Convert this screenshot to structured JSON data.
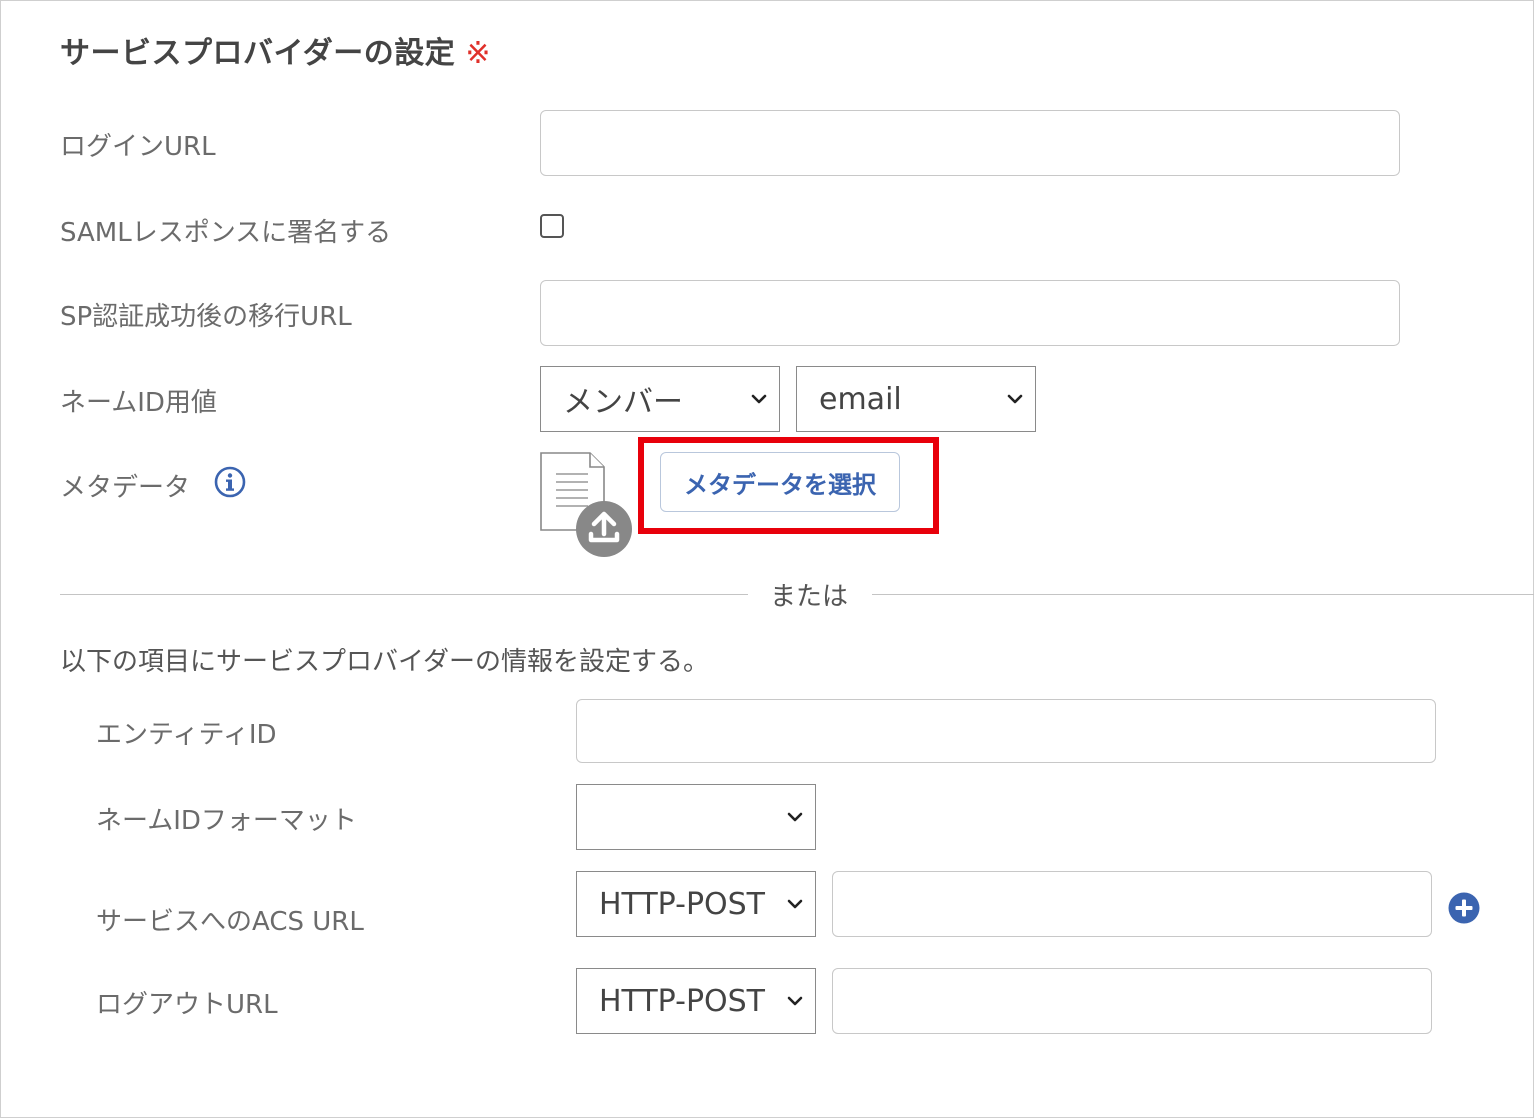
{
  "section": {
    "title": "サービスプロバイダーの設定",
    "required_mark": "※"
  },
  "fields": {
    "login_url": {
      "label": "ログインURL",
      "value": ""
    },
    "saml_sign": {
      "label": "SAMLレスポンスに署名する",
      "checked": false
    },
    "sp_redirect_url": {
      "label": "SP認証成功後の移行URL",
      "value": ""
    },
    "name_id_value": {
      "label": "ネームID用値",
      "select1": "メンバー",
      "select2": "email"
    },
    "metadata": {
      "label": "メタデータ",
      "button": "メタデータを選択",
      "info_icon": "info-icon",
      "file_icon": "document-upload-icon"
    }
  },
  "divider": {
    "text": "または"
  },
  "manual": {
    "intro": "以下の項目にサービスプロバイダーの情報を設定する。",
    "entity_id": {
      "label": "エンティティID",
      "value": ""
    },
    "name_id_format": {
      "label": "ネームIDフォーマット",
      "selected": ""
    },
    "acs_url": {
      "label": "サービスへのACS URL",
      "binding": "HTTP-POST",
      "value": "",
      "add_icon": "plus-circle-icon"
    },
    "logout_url": {
      "label": "ログアウトURL",
      "binding": "HTTP-POST",
      "value": ""
    }
  },
  "colors": {
    "accent": "#3b64b0",
    "required": "#e0302a",
    "highlight": "#e8000b"
  }
}
